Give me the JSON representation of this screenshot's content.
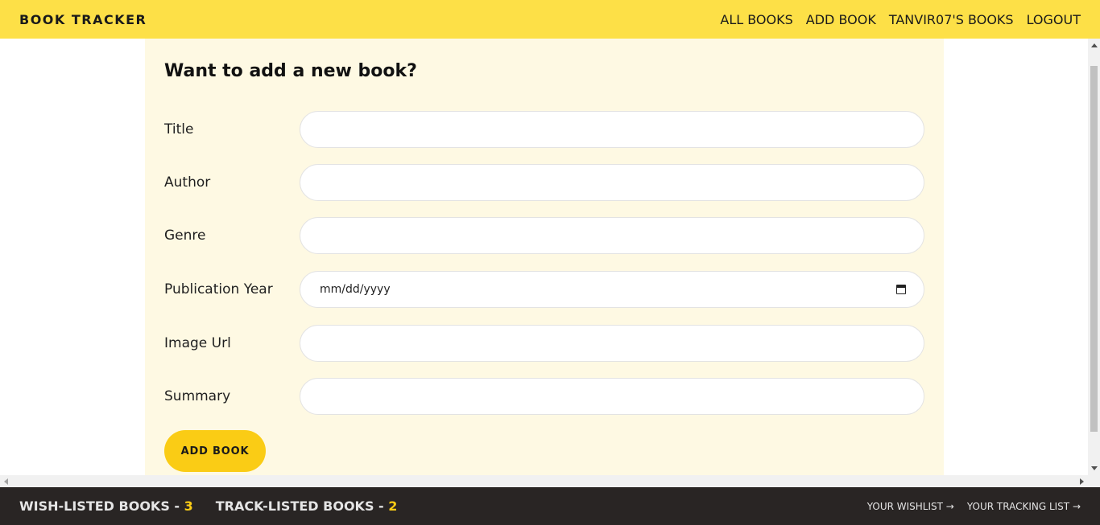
{
  "header": {
    "brand": "BOOK TRACKER",
    "nav": [
      "ALL BOOKS",
      "ADD BOOK",
      "TANVIR07'S BOOKS",
      "LOGOUT"
    ]
  },
  "form": {
    "title": "Want to add a new book?",
    "fields": [
      {
        "label": "Title",
        "value": ""
      },
      {
        "label": "Author",
        "value": ""
      },
      {
        "label": "Genre",
        "value": ""
      },
      {
        "label": "Publication Year",
        "value": "mm/dd/yyyy"
      },
      {
        "label": "Image Url",
        "value": ""
      },
      {
        "label": "Summary",
        "value": ""
      }
    ],
    "submit_label": "ADD BOOK"
  },
  "footer": {
    "wishlisted_label": "WISH-LISTED BOOKS - ",
    "wishlisted_count": "3",
    "tracklisted_label": "TRACK-LISTED BOOKS - ",
    "tracklisted_count": "2",
    "links": [
      "YOUR WISHLIST →",
      "YOUR TRACKING LIST →"
    ]
  },
  "colors": {
    "header_bg": "#fde047",
    "card_bg": "#fef9e3",
    "button_bg": "#facc15",
    "footer_bg": "#292524"
  },
  "icons": [
    "calendar-icon"
  ]
}
